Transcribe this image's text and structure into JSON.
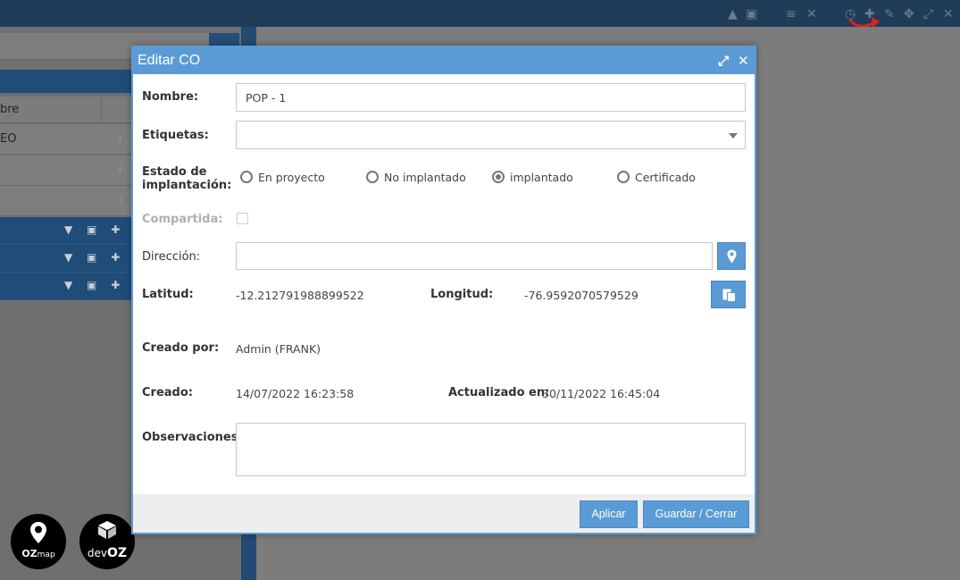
{
  "background": {
    "left_column_header": "bre",
    "left_rows": [
      "EO",
      "",
      ""
    ],
    "accent": "#1f4d78"
  },
  "logos": {
    "ozmap": "OZ",
    "ozmap_suffix": "map",
    "dev_prefix": "dev",
    "dev_suffix": "OZ"
  },
  "dialog": {
    "title": "Editar CO",
    "nombre_label": "Nombre:",
    "nombre_value": "POP - 1",
    "etiquetas_label": "Etiquetas:",
    "estado_label_1": "Estado de",
    "estado_label_2": "implantación:",
    "estado_options": [
      "En proyecto",
      "No implantado",
      "implantado",
      "Certificado"
    ],
    "estado_selected": "implantado",
    "compartida_label": "Compartida:",
    "direccion_label": "Dirección:",
    "latitud_label": "Latitud:",
    "latitud_value": "-12.212791988899522",
    "longitud_label": "Longitud:",
    "longitud_value": "-76.9592070579529",
    "creado_por_label": "Creado por:",
    "creado_por_value": "Admin (FRANK)",
    "creado_label": "Creado:",
    "creado_value": "14/07/2022 16:23:58",
    "actualizado_label": "Actualizado en:",
    "actualizado_value": "30/11/2022 16:45:04",
    "observaciones_label": "Observaciones:",
    "aplicar_label": "Aplicar",
    "guardar_label": "Guardar / Cerrar"
  }
}
